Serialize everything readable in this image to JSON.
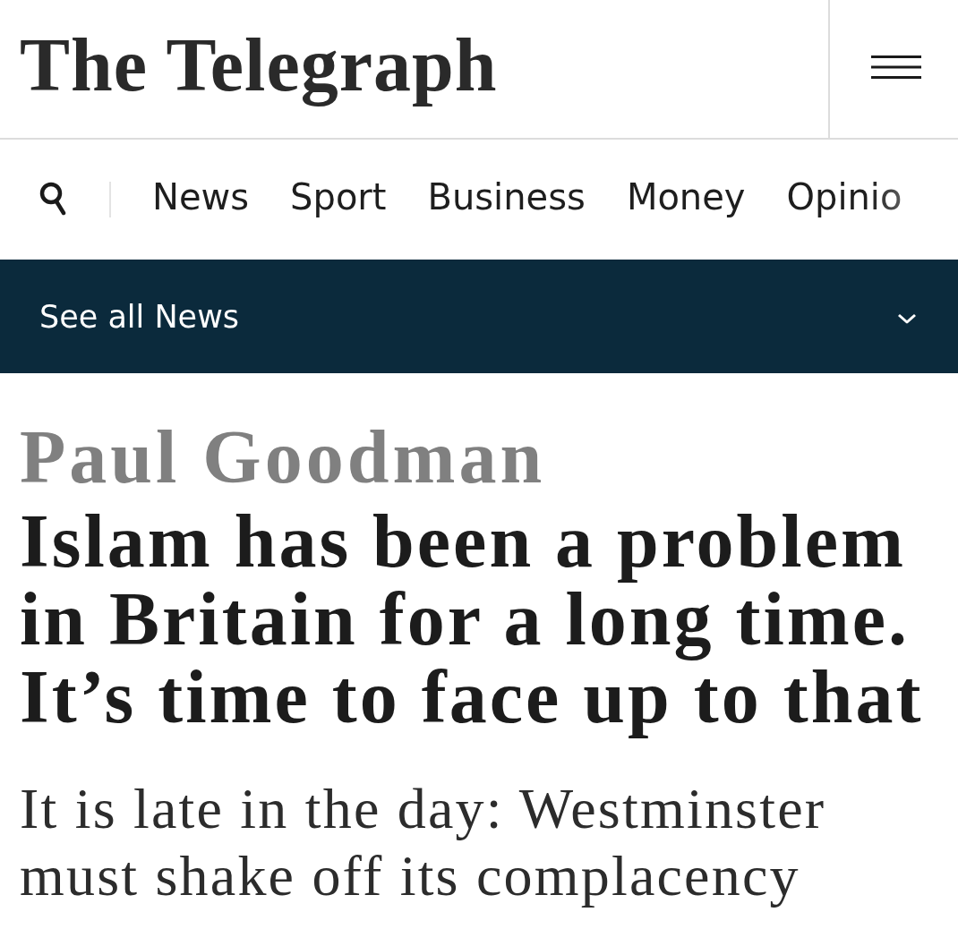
{
  "header": {
    "logo": "The Telegraph"
  },
  "nav": {
    "items": [
      {
        "label": "News",
        "selected": false
      },
      {
        "label": "Sport",
        "selected": false
      },
      {
        "label": "Business",
        "selected": false
      },
      {
        "label": "Money",
        "selected": false
      },
      {
        "label": "Opinio",
        "selected": false
      }
    ]
  },
  "section_bar": {
    "label": "See all News",
    "expanded": false
  },
  "article": {
    "byline": "Paul Goodman",
    "headline": "Islam has been a problem in Britain for a long time. It’s time to face up to that",
    "standfirst": "It is late in the day: Westminster must shake off its complacency"
  }
}
